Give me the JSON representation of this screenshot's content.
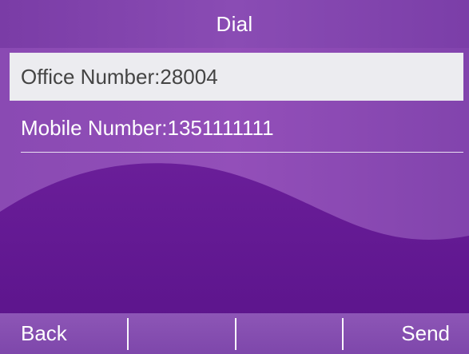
{
  "header": {
    "title": "Dial"
  },
  "list": {
    "items": [
      {
        "label": "Office Number:28004",
        "selected": true
      },
      {
        "label": "Mobile Number:1351111111",
        "selected": false
      }
    ]
  },
  "softkeys": [
    {
      "label": "Back"
    },
    {
      "label": ""
    },
    {
      "label": ""
    },
    {
      "label": "Send"
    }
  ],
  "colors": {
    "background": "#6a1f96",
    "title_bar": "#8a4cb4",
    "selected_row": "#ececf0",
    "softkey_bar": "#8d56b6"
  }
}
